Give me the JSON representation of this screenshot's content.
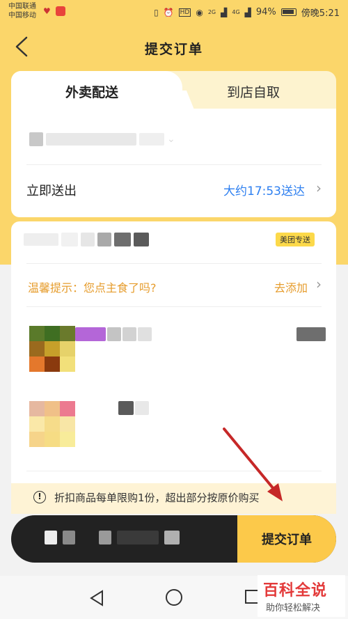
{
  "status_bar": {
    "carrier_1": "中国联通",
    "carrier_2": "中国移动",
    "battery": "94%",
    "time": "傍晚5:21",
    "network_1": "2G",
    "network_2": "4G"
  },
  "header": {
    "title": "提交订单"
  },
  "delivery": {
    "tabs": [
      {
        "label": "外卖配送",
        "active": true
      },
      {
        "label": "到店自取",
        "active": false
      }
    ],
    "deliver_label": "立即送出",
    "eta": "大约17:53送达"
  },
  "order": {
    "badge": "美团专送",
    "tip_text": "温馨提示：您点主食了吗?",
    "tip_action": "去添加"
  },
  "notice": {
    "icon": "!",
    "text": "折扣商品每单限购1份，超出部分按原价购买"
  },
  "bottom_bar": {
    "submit_label": "提交订单"
  },
  "watermark": {
    "title": "百科全说",
    "subtitle": "助你轻松解决"
  },
  "colors": {
    "header_bg": "#fbd66a",
    "accent_blue": "#2d7ff0",
    "tip_orange": "#e69c2c",
    "submit_bg": "#fcc94a",
    "bar_dark": "#222222",
    "arrow_red": "#c62828"
  }
}
